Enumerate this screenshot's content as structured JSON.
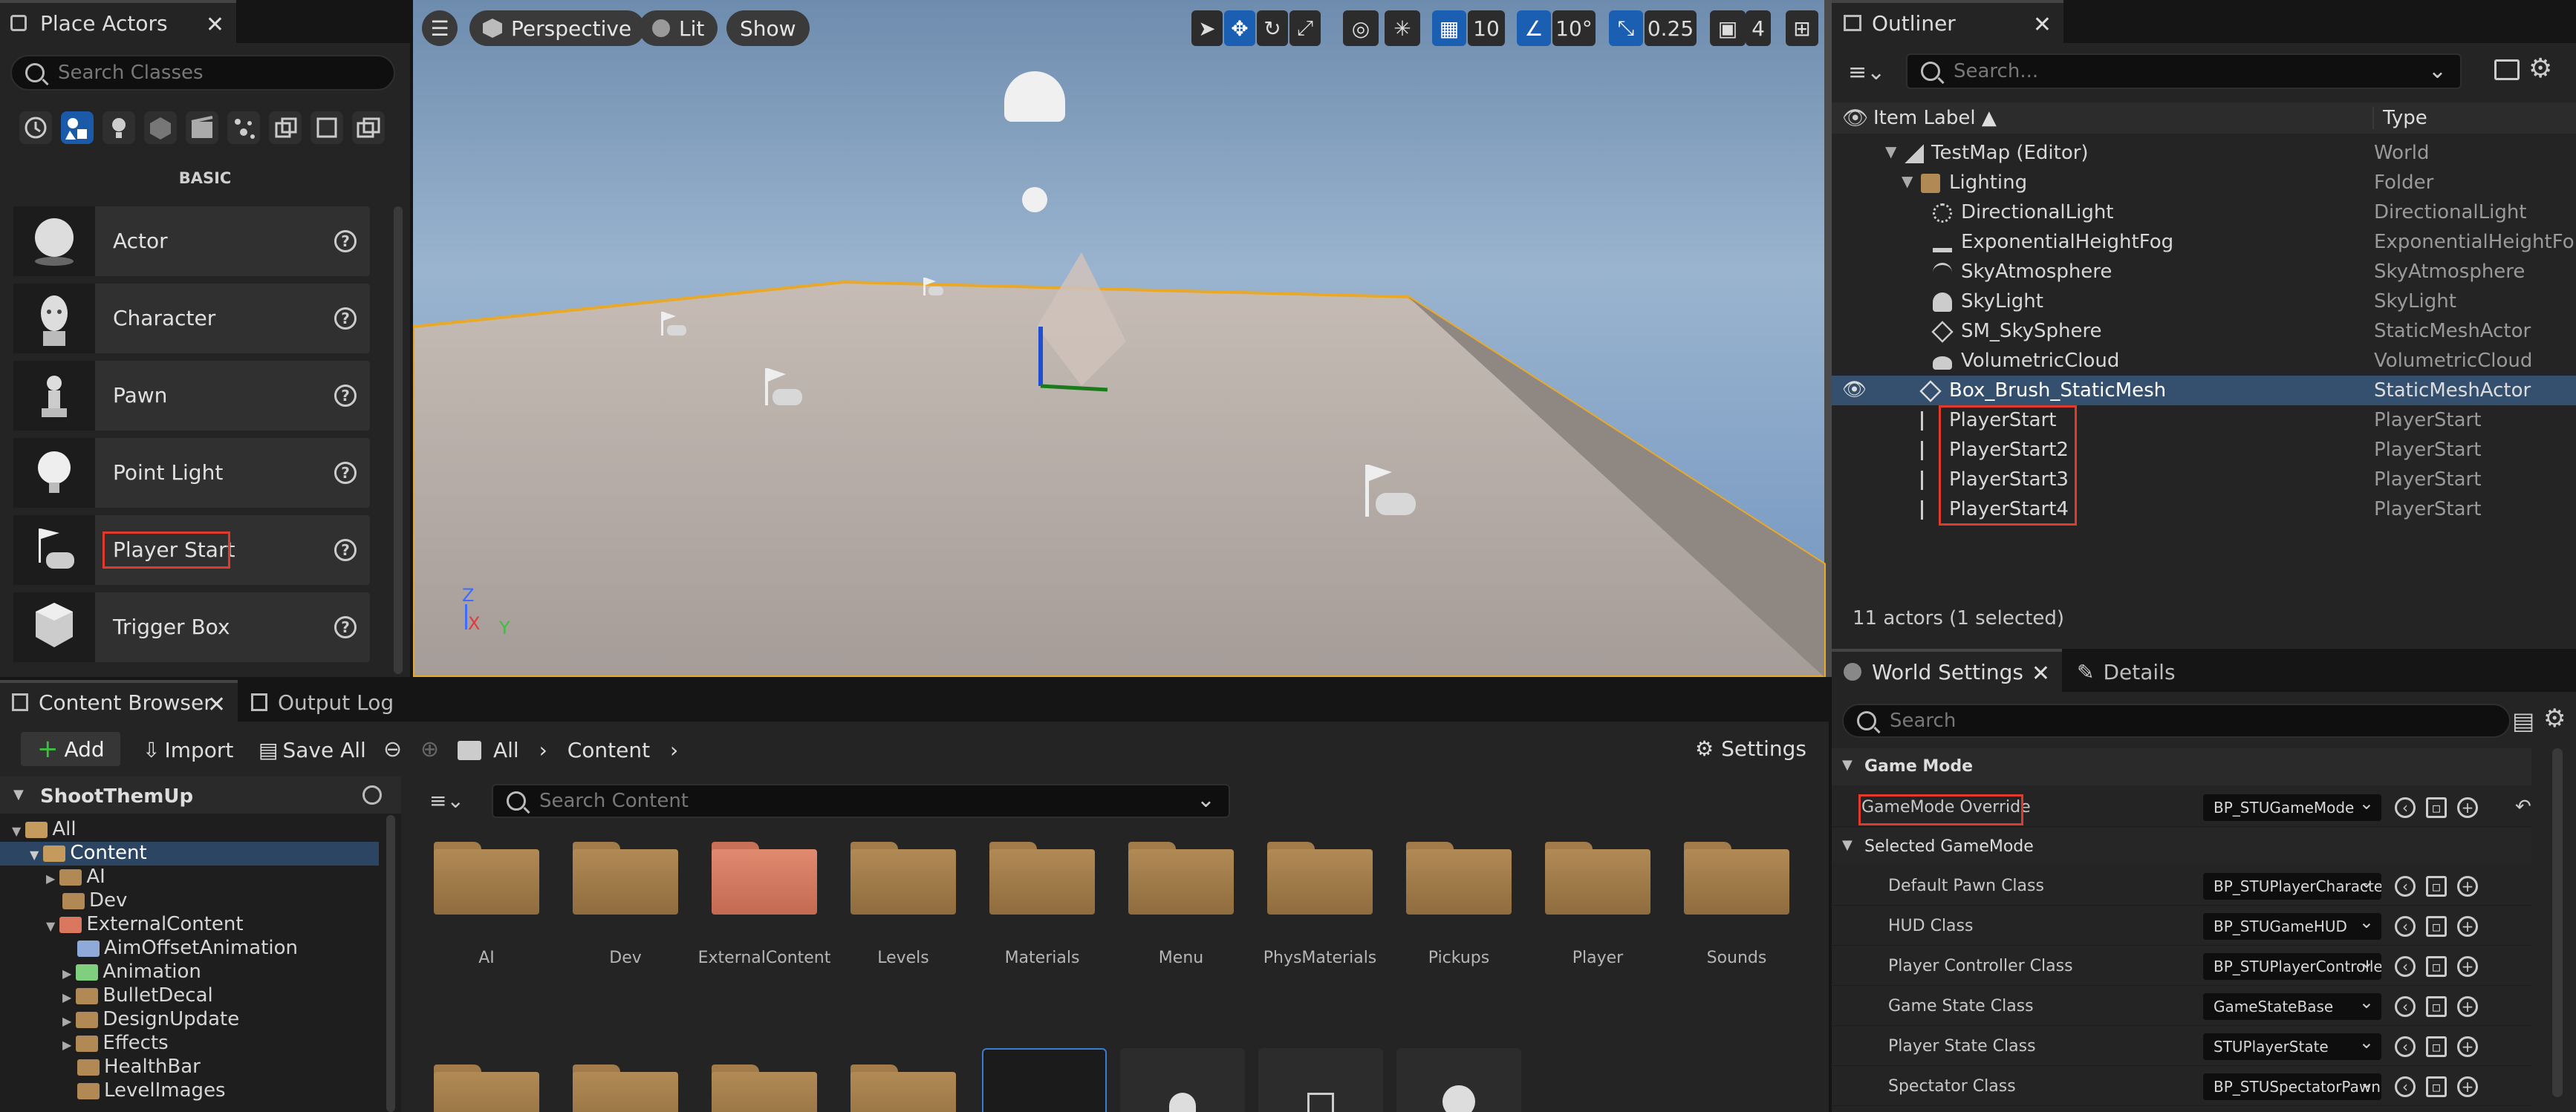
{
  "place_actors": {
    "tab_title": "Place Actors",
    "search_placeholder": "Search Classes",
    "section_label": "BASIC",
    "items": [
      {
        "label": "Actor",
        "icon": "sphere-icon"
      },
      {
        "label": "Character",
        "icon": "mannequin-icon"
      },
      {
        "label": "Pawn",
        "icon": "pawn-icon"
      },
      {
        "label": "Point Light",
        "icon": "lightbulb-icon"
      },
      {
        "label": "Player Start",
        "icon": "flag-gamepad-icon"
      },
      {
        "label": "Trigger Box",
        "icon": "cube-icon"
      }
    ]
  },
  "viewport": {
    "perspective_label": "Perspective",
    "lit_label": "Lit",
    "show_label": "Show",
    "grid_snap": "10",
    "rotation_snap": "10°",
    "scale_snap": "0.25",
    "camera_speed": "4",
    "axis": {
      "z": "Z",
      "x": "X",
      "y": "Y"
    }
  },
  "outliner": {
    "tab_title": "Outliner",
    "search_placeholder": "Search...",
    "col_label": "Item Label ▲",
    "col_type": "Type",
    "rows": [
      {
        "name": "TestMap (Editor)",
        "type": "World",
        "indent": 1
      },
      {
        "name": "Lighting",
        "type": "Folder",
        "indent": 2
      },
      {
        "name": "DirectionalLight",
        "type": "DirectionalLight",
        "indent": 3
      },
      {
        "name": "ExponentialHeightFog",
        "type": "ExponentialHeightFog",
        "indent": 3
      },
      {
        "name": "SkyAtmosphere",
        "type": "SkyAtmosphere",
        "indent": 3
      },
      {
        "name": "SkyLight",
        "type": "SkyLight",
        "indent": 3
      },
      {
        "name": "SM_SkySphere",
        "type": "StaticMeshActor",
        "indent": 3
      },
      {
        "name": "VolumetricCloud",
        "type": "VolumetricCloud",
        "indent": 3
      },
      {
        "name": "Box_Brush_StaticMesh",
        "type": "StaticMeshActor",
        "indent": 2
      },
      {
        "name": "PlayerStart",
        "type": "PlayerStart",
        "indent": 2
      },
      {
        "name": "PlayerStart2",
        "type": "PlayerStart",
        "indent": 2
      },
      {
        "name": "PlayerStart3",
        "type": "PlayerStart",
        "indent": 2
      },
      {
        "name": "PlayerStart4",
        "type": "PlayerStart",
        "indent": 2
      }
    ],
    "status": "11 actors (1 selected)"
  },
  "world_settings": {
    "tab_title": "World Settings",
    "details_tab": "Details",
    "search_placeholder": "Search",
    "section_game_mode": "Game Mode",
    "gamemode_override_label": "GameMode Override",
    "gamemode_override_value": "BP_STUGameMode",
    "section_selected": "Selected GameMode",
    "rows": [
      {
        "label": "Default Pawn Class",
        "value": "BP_STUPlayerCharacter"
      },
      {
        "label": "HUD Class",
        "value": "BP_STUGameHUD"
      },
      {
        "label": "Player Controller Class",
        "value": "BP_STUPlayerController"
      },
      {
        "label": "Game State Class",
        "value": "GameStateBase"
      },
      {
        "label": "Player State Class",
        "value": "STUPlayerState"
      },
      {
        "label": "Spectator Class",
        "value": "BP_STUSpectatorPawn"
      }
    ]
  },
  "content_browser": {
    "tab_title": "Content Browser",
    "output_log_tab": "Output Log",
    "add_label": "Add",
    "import_label": "Import",
    "save_all_label": "Save All",
    "breadcrumb": [
      "All",
      "Content"
    ],
    "settings_label": "Settings",
    "project_name": "ShootThemUp",
    "search_placeholder": "Search Content",
    "tree": [
      {
        "label": "All",
        "indent": 0
      },
      {
        "label": "Content",
        "indent": 1
      },
      {
        "label": "AI",
        "indent": 2
      },
      {
        "label": "Dev",
        "indent": 2
      },
      {
        "label": "ExternalContent",
        "indent": 2
      },
      {
        "label": "AimOffsetAnimation",
        "indent": 3
      },
      {
        "label": "Animation",
        "indent": 3
      },
      {
        "label": "BulletDecal",
        "indent": 3
      },
      {
        "label": "DesignUpdate",
        "indent": 3
      },
      {
        "label": "Effects",
        "indent": 3
      },
      {
        "label": "HealthBar",
        "indent": 3
      },
      {
        "label": "LevelImages",
        "indent": 3
      }
    ],
    "folders": [
      "AI",
      "Dev",
      "ExternalContent",
      "Levels",
      "Materials",
      "Menu",
      "PhysMaterials",
      "Pickups",
      "Player",
      "Sounds"
    ]
  }
}
